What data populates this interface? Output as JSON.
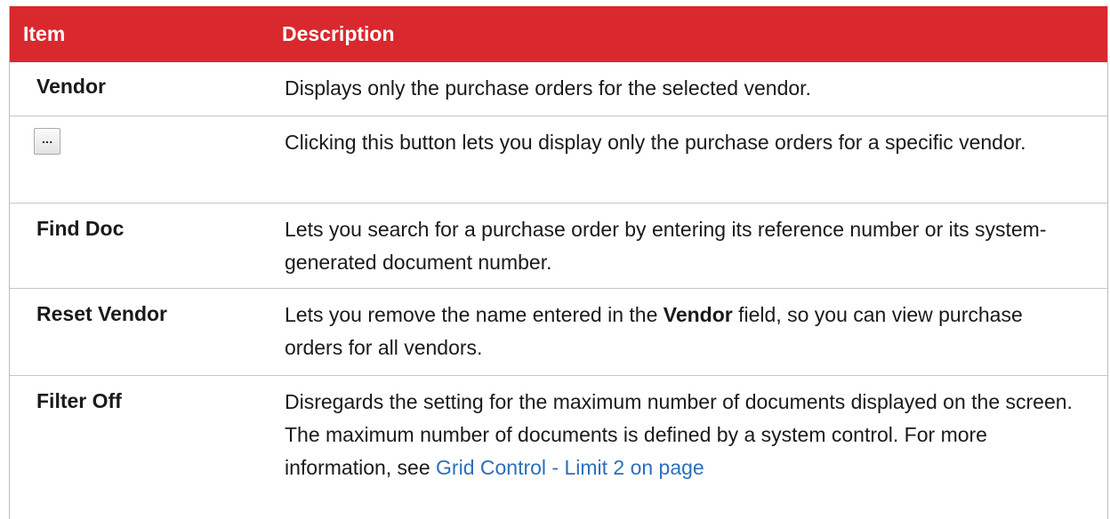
{
  "header": {
    "item": "Item",
    "description": "Description"
  },
  "rows": [
    {
      "item": "Vendor",
      "description": "Displays only the purchase orders for the selected vendor."
    },
    {
      "item_icon": "ellipsis-button",
      "item_button_label": "...",
      "description": "Clicking this button lets you display only the purchase orders for a specific vendor."
    },
    {
      "item": "Find Doc",
      "description": "Lets you search for a purchase order by entering its reference number or its system-generated document number."
    },
    {
      "item": "Reset Vendor",
      "description_before": "Lets you remove the name entered in the ",
      "description_bold": "Vendor",
      "description_after": " field, so you can view purchase orders for all vendors."
    },
    {
      "item": "Filter Off",
      "description": "Disregards the setting for the maximum number of documents displayed on the screen. The maximum number of documents is defined by a system control. For more information, see ",
      "link_text": "Grid Control - Limit 2 on page"
    }
  ],
  "colors": {
    "header_bg": "#d9282e",
    "header_text": "#ffffff",
    "link": "#2c6fbd"
  }
}
